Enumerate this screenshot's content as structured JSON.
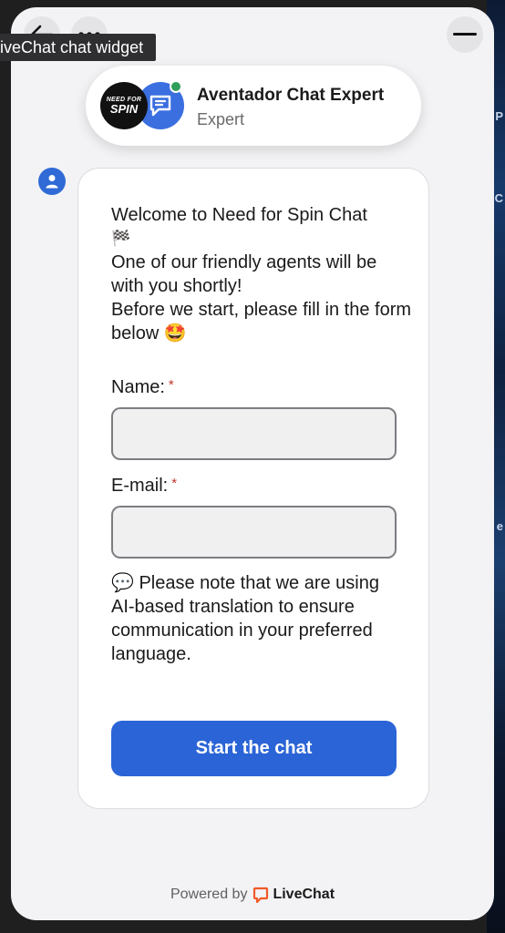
{
  "header": {
    "tooltip": "LiveChat chat widget"
  },
  "agent": {
    "logo_top": "NEED FOR",
    "logo_bottom": "SPIN",
    "name": "Aventador Chat Expert",
    "role": "Expert",
    "status_color": "#2e9e5b"
  },
  "message": {
    "line1": "Welcome to Need for Spin Chat",
    "flag": "🏁",
    "line2": "One of our friendly agents will be with you shortly!",
    "line3": "Before we start, please fill in the form below 🤩"
  },
  "form": {
    "name_label": "Name:",
    "email_label": "E-mail:",
    "required_marker": "*",
    "name_value": "",
    "email_value": "",
    "note_icon": "💬",
    "note": "Please note that we are using AI-based translation to ensure communication in your preferred language.",
    "submit_label": "Start the chat"
  },
  "footer": {
    "powered_by": "Powered by",
    "brand": "LiveChat",
    "brand_color": "#f05a28"
  },
  "colors": {
    "accent": "#2b64d6",
    "widget_bg": "#f3f3f5"
  }
}
